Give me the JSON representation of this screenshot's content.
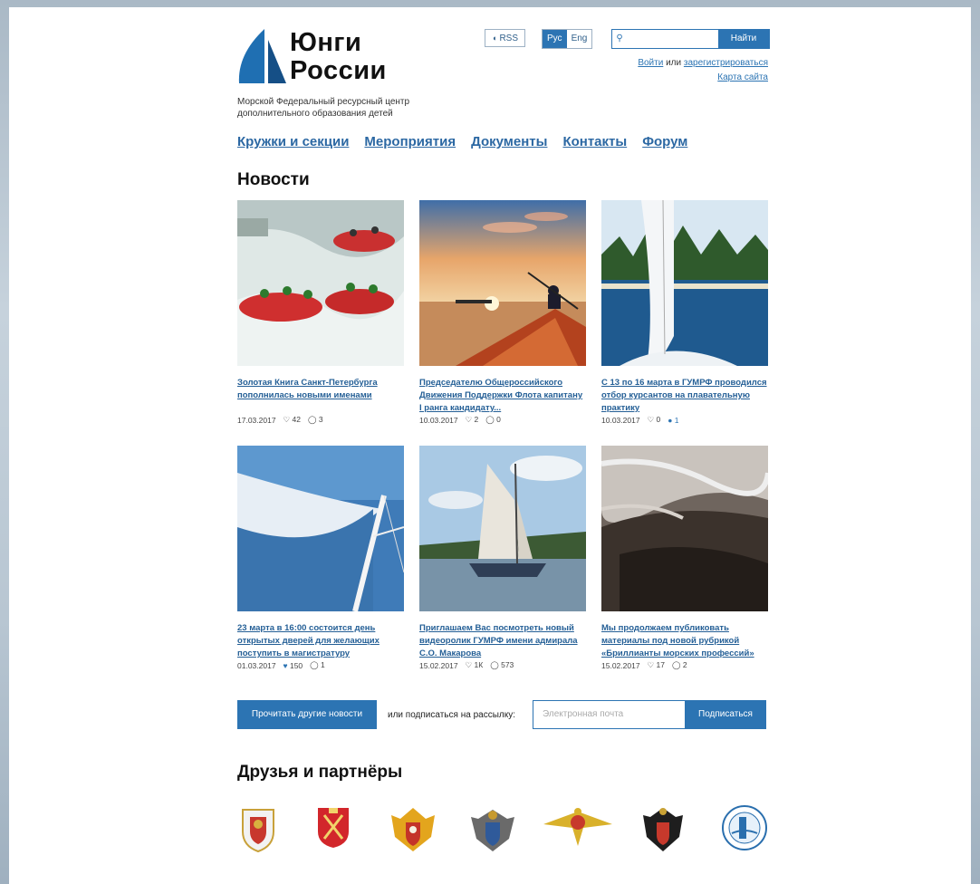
{
  "logo": {
    "line1": "Юнги",
    "line2": "России",
    "tagline": "Морской Федеральный ресурсный центр дополнительного образования детей"
  },
  "header": {
    "rss": "RSS",
    "lang_ru": "Рус",
    "lang_en": "Eng",
    "search_placeholder": "",
    "search_button": "Найти",
    "login": "Войти",
    "or": "или",
    "register": "зарегистрироваться",
    "sitemap": "Карта сайта"
  },
  "nav": [
    "Кружки и секции",
    "Мероприятия",
    "Документы",
    "Контакты",
    "Форум"
  ],
  "news_heading": "Новости",
  "news": [
    {
      "title": "Золотая Книга Санкт-Петербурга пополнилась новыми именами",
      "date": "17.03.2017",
      "likes": "42",
      "comments": "3"
    },
    {
      "title": "Председателю Общероссийского Движения Поддержки Флота капитану I ранга кандидату...",
      "date": "10.03.2017",
      "likes": "2",
      "comments": "0"
    },
    {
      "title": "С 13 по 16 марта в ГУМРФ проводился отбор курсантов на плавательную практику",
      "date": "10.03.2017",
      "likes": "0",
      "comments": "1"
    },
    {
      "title": "23 марта в 16:00 состоится день открытых дверей для желающих поступить в магистратуру",
      "date": "01.03.2017",
      "likes": "150",
      "comments": "1"
    },
    {
      "title": "Приглашаем Вас посмотреть новый видеоролик ГУМРФ имени адмирала С.О. Макарова",
      "date": "15.02.2017",
      "likes": "1К",
      "comments": "573"
    },
    {
      "title": "Мы продолжаем публиковать материалы под новой рубрикой «Бриллианты морских профессий»",
      "date": "15.02.2017",
      "likes": "17",
      "comments": "2"
    }
  ],
  "more_news": "Прочитать другие новости",
  "or_subscribe": "или подписаться на рассылку:",
  "email_placeholder": "Электронная почта",
  "subscribe_button": "Подписаться",
  "partners_heading": "Друзья и партнёры",
  "partners": [
    "emblem-1",
    "emblem-2",
    "emblem-3",
    "emblem-4",
    "emblem-5",
    "emblem-6",
    "emblem-7"
  ],
  "colors": {
    "accent": "#2c74b3",
    "link": "#245f96"
  }
}
